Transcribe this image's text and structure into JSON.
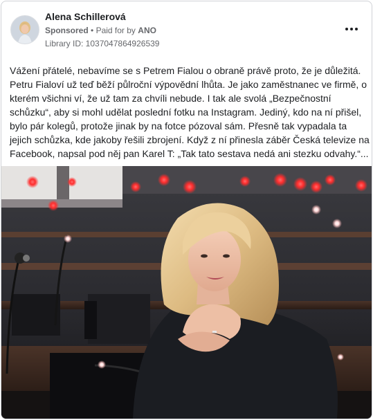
{
  "post": {
    "page_name": "Alena Schillerová",
    "sponsored_label": "Sponsored",
    "separator": "•",
    "paid_for_prefix": "Paid for by",
    "paid_for_name": "ANO",
    "library_id": "Library ID: 1037047864926539",
    "more_icon": "more-horizontal-icon",
    "text": "Vážení přátelé, nebavíme se s Petrem Fialou o obraně právě proto, že je důležitá.\nPetru Fialoví už teď běží půlroční výpovědní lhůta. Je jako zaměstnanec ve firmě, o\nkterém všichni ví, že už tam za chvíli nebude. I tak ale svolá „Bezpečnostní\nschůzku“, aby si mohl udělat poslední fotku na Instagram. Jediný, kdo na ní přišel,\nbylo pár kolegů, protože jinak by na fotce pózoval sám. Přesně tak vypadala ta\njejich schůzka, kde jakoby řešili zbrojení. Když z ní přinesla záběr Česká televize na\nFacebook, napsal pod něj pan Karel T: „Tak tato sestava nedá ani stezku odvahy.“..."
  },
  "colors": {
    "text_primary": "#1c1e21",
    "text_secondary": "#65676b",
    "border": "#d0d2d6",
    "light_red": "#ff3b3b"
  }
}
